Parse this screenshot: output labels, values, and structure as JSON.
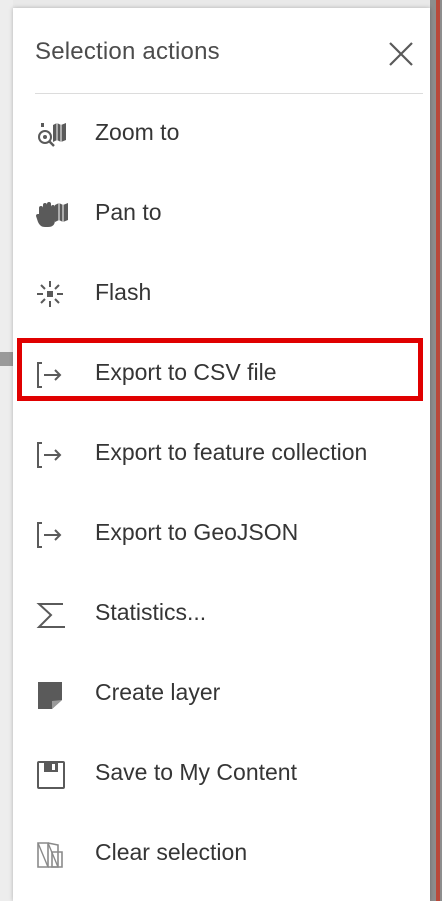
{
  "panel": {
    "title": "Selection actions",
    "close_icon": "close-icon"
  },
  "items": [
    {
      "label": "Zoom to",
      "icon": "zoom-to-icon"
    },
    {
      "label": "Pan to",
      "icon": "pan-to-icon"
    },
    {
      "label": "Flash",
      "icon": "flash-icon"
    },
    {
      "label": "Export to CSV file",
      "icon": "export-icon",
      "highlighted": true
    },
    {
      "label": "Export to feature collection",
      "icon": "export-icon"
    },
    {
      "label": "Export to GeoJSON",
      "icon": "export-icon"
    },
    {
      "label": "Statistics...",
      "icon": "sigma-icon"
    },
    {
      "label": "Create layer",
      "icon": "create-layer-icon"
    },
    {
      "label": "Save to My Content",
      "icon": "save-icon"
    },
    {
      "label": "Clear selection",
      "icon": "clear-selection-icon"
    }
  ],
  "colors": {
    "highlight_border": "#e00000",
    "text": "#353535",
    "title": "#4c4c4c",
    "icon": "#5a5a5a"
  }
}
